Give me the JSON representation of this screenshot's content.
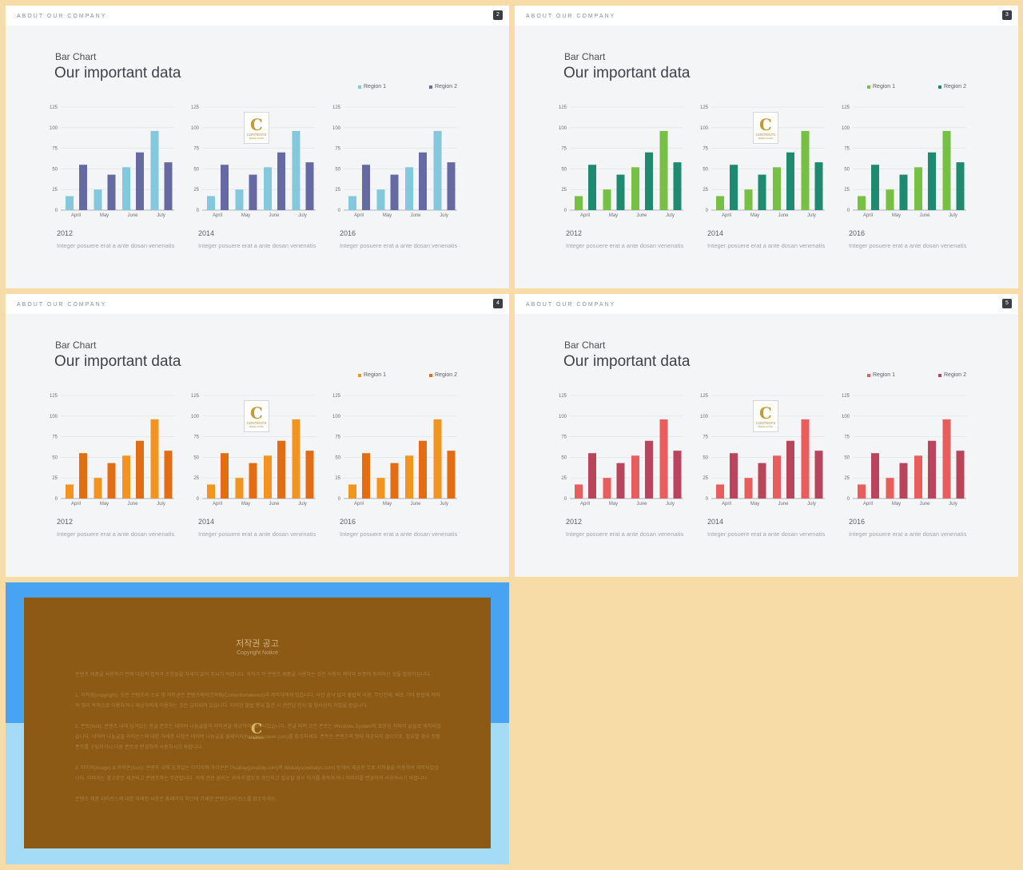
{
  "brand": "ABOUT OUR COMPANY",
  "chart_common": {
    "subtitle": "Bar Chart",
    "title": "Our important data",
    "legend": [
      "Region 1",
      "Region 2"
    ],
    "description": "Integer posuere erat a ante dosan venenatis"
  },
  "logo": {
    "mark": "C",
    "text": "CONTENTS",
    "subtext": "MAKE COOK"
  },
  "slides": [
    {
      "page": "2",
      "colors": [
        "#83c8dc",
        "#666aa3"
      ]
    },
    {
      "page": "3",
      "colors": [
        "#76c043",
        "#1f8a70"
      ]
    },
    {
      "page": "4",
      "colors": [
        "#f2951f",
        "#e26d12"
      ]
    },
    {
      "page": "5",
      "colors": [
        "#e95d5d",
        "#b8455c"
      ]
    }
  ],
  "chart_data": {
    "type": "bar",
    "categories": [
      "April",
      "May",
      "June",
      "July"
    ],
    "series": [
      {
        "name": "Region 1",
        "values": [
          17,
          25,
          52,
          96
        ]
      },
      {
        "name": "Region 2",
        "values": [
          55,
          43,
          70,
          58
        ]
      }
    ],
    "ylim": [
      0,
      125
    ],
    "yticks": [
      0,
      25,
      50,
      75,
      100,
      125
    ],
    "panels": [
      "2012",
      "2014",
      "2016"
    ],
    "grid": true
  },
  "copyright": {
    "title": "저작권 공고",
    "subtitle": "Copyright Notice",
    "paragraphs": [
      "콘텐츠 제품을 사용하기 전에 다음의 법적과 조항들을 자세히 읽어 주시기 바랍니다. 귀하가 이 콘텐츠 제품을 사용하는 것은 사용자 계약과 보증에 동의하신 것을 말씀하십니다.",
      "1. 저작권(copyright): 모든 콘텐츠의 소유 및 저작권은 콘텐츠메이크어웨(Contentsmakeout)과 제작자에게 있습니다. 사전 승낙 없이 불법적 이용, 무단전재, 배포 기타 방법에 의하여 영리 목적으로 이용하거나 제삼자에게 이용하는 것은 금지되어 있습니다. 이러한 불법 행위 발견 시 관련된 민사 및 형사상의 처벌을 받습니다.",
      "2. 폰트(font): 콘텐츠 내에 담겨있는 한글 폰트는 네이버 나눔글꼴의 저작권을 제공하여 제작되었습니다. 한글 외의 모든 폰트는 Windows System에 포함된 저체의 글꼴로 제작되었습니다. 네이버 나눔글꼴 라이선스에 대한 자세한 사항은 네이버 나눔글꼴 홈페이지(hangeul.naver.com)를 참조하세요. 폰트는 콘텐츠의 형태 재공되지 않으므로, 필요할 경우 정품 폰트를 구입하거나 다른 폰트로 변경하여 사용하시기 바랍니다.",
      "3. 이미지(image) & 아이콘(icon): 콘텐츠 내에 담겨있는 이미지와 아이콘은 Pixabay(pixabay.com)와 Webalys(webalys.com) 등에서 제공한 무료 저작물을 이용하여 제작되었습니다. 이미지는 참고로만 제공되고 콘텐츠와는 무관합니다. 이에 관한 권리는 귀하가 별도로 확인하고 필요할 경우 허가를 취득하거나 이미지를 변경하여 사용하시기 바랍니다.",
      "콘텐츠 제품 라이선스에 대한 자세한 사항은 홈페이지 하단에 기재한 콘텐츠라이선스를 참조하세요."
    ]
  }
}
